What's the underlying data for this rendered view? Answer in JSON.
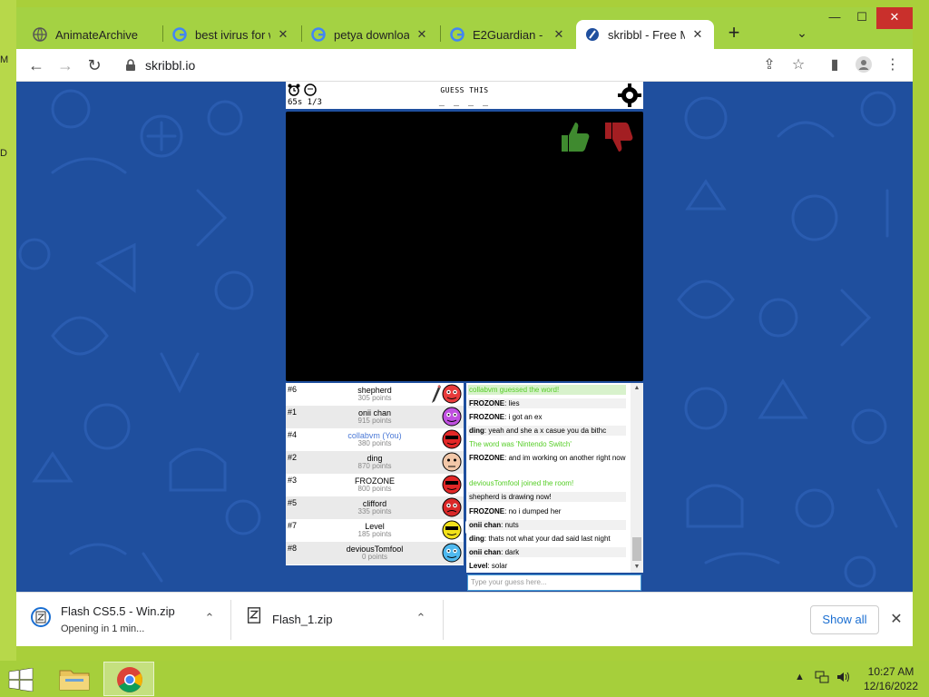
{
  "desktop": {
    "left_labels": [
      "M",
      "D"
    ]
  },
  "browser": {
    "tabs": [
      {
        "title": "AnimateArchive",
        "icon": "globe-icon"
      },
      {
        "title": "best ivirus for w",
        "icon": "google-icon"
      },
      {
        "title": "petya download",
        "icon": "google-icon"
      },
      {
        "title": "E2Guardian - Un",
        "icon": "google-icon"
      },
      {
        "title": "skribbl - Free M",
        "icon": "skribbl-icon",
        "active": true
      }
    ],
    "url": "skribbl.io",
    "window_controls": {
      "minimize": "—",
      "maximize": "☐",
      "close": "✕"
    }
  },
  "game": {
    "timer": "65s 1/3",
    "guess_label": "GUESS THIS",
    "word_hint": "_ _ _ _",
    "players": [
      {
        "rank": "#6",
        "name": "shepherd",
        "points": "305 points",
        "drawing": true,
        "avatar_color": "#e83b3b"
      },
      {
        "rank": "#1",
        "name": "onii chan",
        "points": "915 points",
        "avatar_color": "#c050e0"
      },
      {
        "rank": "#4",
        "name": "collabvm (You)",
        "points": "380 points",
        "you": true,
        "avatar_color": "#e22727"
      },
      {
        "rank": "#2",
        "name": "ding",
        "points": "870 points",
        "avatar_color": "#f2c7a8"
      },
      {
        "rank": "#3",
        "name": "FROZONE",
        "points": "800 points",
        "avatar_color": "#e22727"
      },
      {
        "rank": "#5",
        "name": "clifford",
        "points": "335 points",
        "avatar_color": "#d92828"
      },
      {
        "rank": "#7",
        "name": "Level",
        "points": "185 points",
        "avatar_color": "#f3e21a"
      },
      {
        "rank": "#8",
        "name": "deviousTomfool",
        "points": "0 points",
        "avatar_color": "#4fb9ef"
      }
    ],
    "speech_bubble": "solar",
    "chat": [
      {
        "text": "collabvm guessed the word!",
        "style": "greenbg"
      },
      {
        "author": "FROZONE",
        "text": "lies",
        "style": "odd"
      },
      {
        "author": "FROZONE",
        "text": "i got an ex",
        "style": ""
      },
      {
        "author": "ding",
        "text": "yeah and she a x casue you da bithc",
        "style": "odd"
      },
      {
        "text": "The word was 'Nintendo Switch'",
        "style": "green"
      },
      {
        "author": "FROZONE",
        "text": "and im working on another right now",
        "style": ""
      },
      {
        "text": "deviousTomfool joined the room!",
        "style": "green"
      },
      {
        "text": "shepherd is drawing now!",
        "style": "odd"
      },
      {
        "author": "FROZONE",
        "text": "no i dumped her",
        "style": ""
      },
      {
        "author": "onii chan",
        "text": "nuts",
        "style": "odd"
      },
      {
        "author": "ding",
        "text": "thats not what your dad said last night",
        "style": ""
      },
      {
        "author": "onii chan",
        "text": "dark",
        "style": "odd"
      },
      {
        "author": "Level",
        "text": "solar",
        "style": ""
      }
    ],
    "chat_placeholder": "Type your guess here..."
  },
  "downloads": [
    {
      "name": "Flash CS5.5 - Win.zip",
      "status": "Opening in 1 min..."
    },
    {
      "name": "Flash_1.zip",
      "status": ""
    }
  ],
  "downloads_show_all": "Show all",
  "taskbar": {
    "time": "10:27 AM",
    "date": "12/16/2022"
  }
}
